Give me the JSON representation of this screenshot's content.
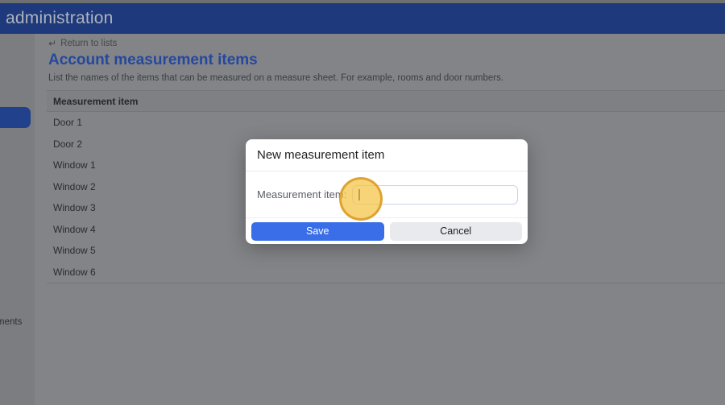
{
  "header": {
    "title": "administration"
  },
  "sidebar": {
    "partial_label": "ments"
  },
  "page": {
    "back_icon": "↵",
    "back_link": "Return to lists",
    "title": "Account measurement items",
    "description": "List the names of the items that can be measured on a measure sheet. For example, rooms and door numbers.",
    "table": {
      "header": "Measurement item",
      "rows": [
        "Door 1",
        "Door 2",
        "Window 1",
        "Window 2",
        "Window 3",
        "Window 4",
        "Window 5",
        "Window 6"
      ]
    }
  },
  "modal": {
    "title": "New measurement item",
    "field_label": "Measurement item:",
    "input_value": "",
    "save_label": "Save",
    "cancel_label": "Cancel"
  },
  "colors": {
    "header-bg": "#1e3a7c",
    "sidebar-bg": "#7c7d80",
    "content-bg": "#838487",
    "active-item": "#21418d",
    "title-color": "#25489e",
    "accent": "#3a6ee8",
    "highlight": "#f5c445"
  }
}
